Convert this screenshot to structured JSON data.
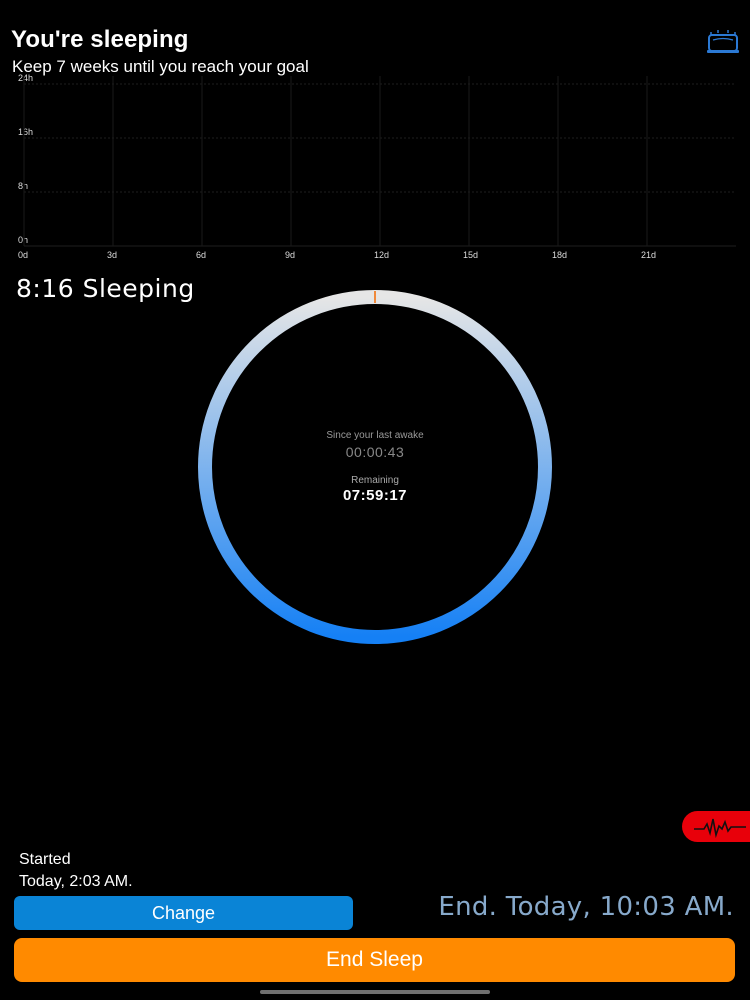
{
  "header": {
    "title": "You're sleeping",
    "subtitle": "Keep 7 weeks until you reach your goal",
    "pillow_icon": "pillow-icon"
  },
  "chart_data": {
    "type": "bar",
    "x": [
      "0d",
      "3d",
      "6d",
      "9d",
      "12d",
      "15d",
      "18d",
      "21d"
    ],
    "y_ticks": [
      "0h",
      "8h",
      "16h",
      "24h"
    ],
    "xlim": [
      0,
      24
    ],
    "ylim": [
      0,
      24
    ],
    "grid": true,
    "values": []
  },
  "summary": {
    "text": "8:16 Sleeping"
  },
  "timer": {
    "since_label": "Since your last awake",
    "since_value": "00:00:43",
    "remaining_label": "Remaining",
    "remaining_value": "07:59:17",
    "progress": 0.0,
    "colors": {
      "top": "#e6e6e6",
      "bottom": "#1580f5",
      "marker": "#f08a3c"
    }
  },
  "heart_badge": {
    "icon": "heartbeat-icon",
    "color": "#e8000a"
  },
  "started": {
    "label": "Started",
    "value": "Today, 2:03 AM."
  },
  "change_button": {
    "label": "Change",
    "color": "#0a84d6"
  },
  "end_time": {
    "text": "End. Today, 10:03 AM."
  },
  "end_sleep_button": {
    "label": "End Sleep",
    "color": "#ff8a00"
  }
}
